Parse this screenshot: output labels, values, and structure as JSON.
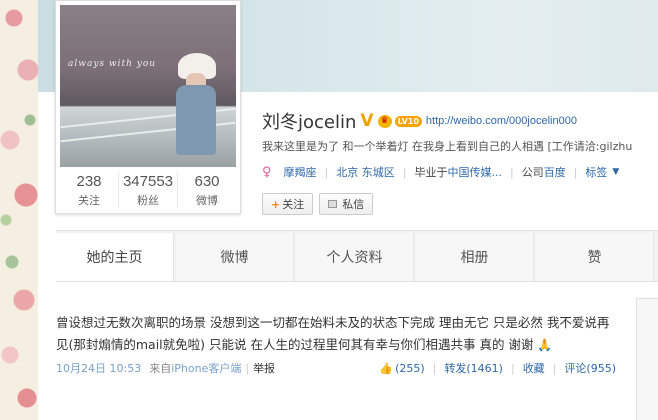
{
  "profile": {
    "name": "刘冬jocelin",
    "verified_badge": "V",
    "level_badge": "LV10",
    "url": "http://weibo.com/000jocelin000",
    "bio": "我来这里是为了 和一个举着灯 在我身上看到自己的人相遇 [工作请洽:gilzhu",
    "avatar_caption": "always with you",
    "stats": [
      {
        "num": "238",
        "label": "关注"
      },
      {
        "num": "347553",
        "label": "粉丝"
      },
      {
        "num": "630",
        "label": "微博"
      }
    ],
    "meta": {
      "gender_icon": "female-icon",
      "zodiac": "摩羯座",
      "location": "北京 东城区",
      "education_prefix": "毕业于",
      "education": "中国传媒...",
      "company_prefix": "公司",
      "company": "百度",
      "tags": "标签"
    },
    "buttons": {
      "follow": "关注",
      "message": "私信"
    }
  },
  "tabs": [
    {
      "label": "她的主页"
    },
    {
      "label": "微博"
    },
    {
      "label": "个人资料"
    },
    {
      "label": "相册"
    },
    {
      "label": "赞"
    }
  ],
  "post": {
    "text": "曾设想过无数次离职的场景 没想到这一切都在始料未及的状态下完成 理由无它 只是必然 我不爱说再见(那封煽情的mail就免啦) 只能说 在人生的过程里何其有幸与你们相遇共事 真的 谢谢",
    "time": "10月24日 10:53",
    "source_prefix": "来自",
    "source": "iPhone客户端",
    "report": "举报",
    "likes": "(255)",
    "repost": "转发(1461)",
    "favorite": "收藏",
    "comment": "评论(955)"
  },
  "colors": {
    "link": "#2f68a8",
    "accent": "#f08c00",
    "female": "#e0609a"
  }
}
